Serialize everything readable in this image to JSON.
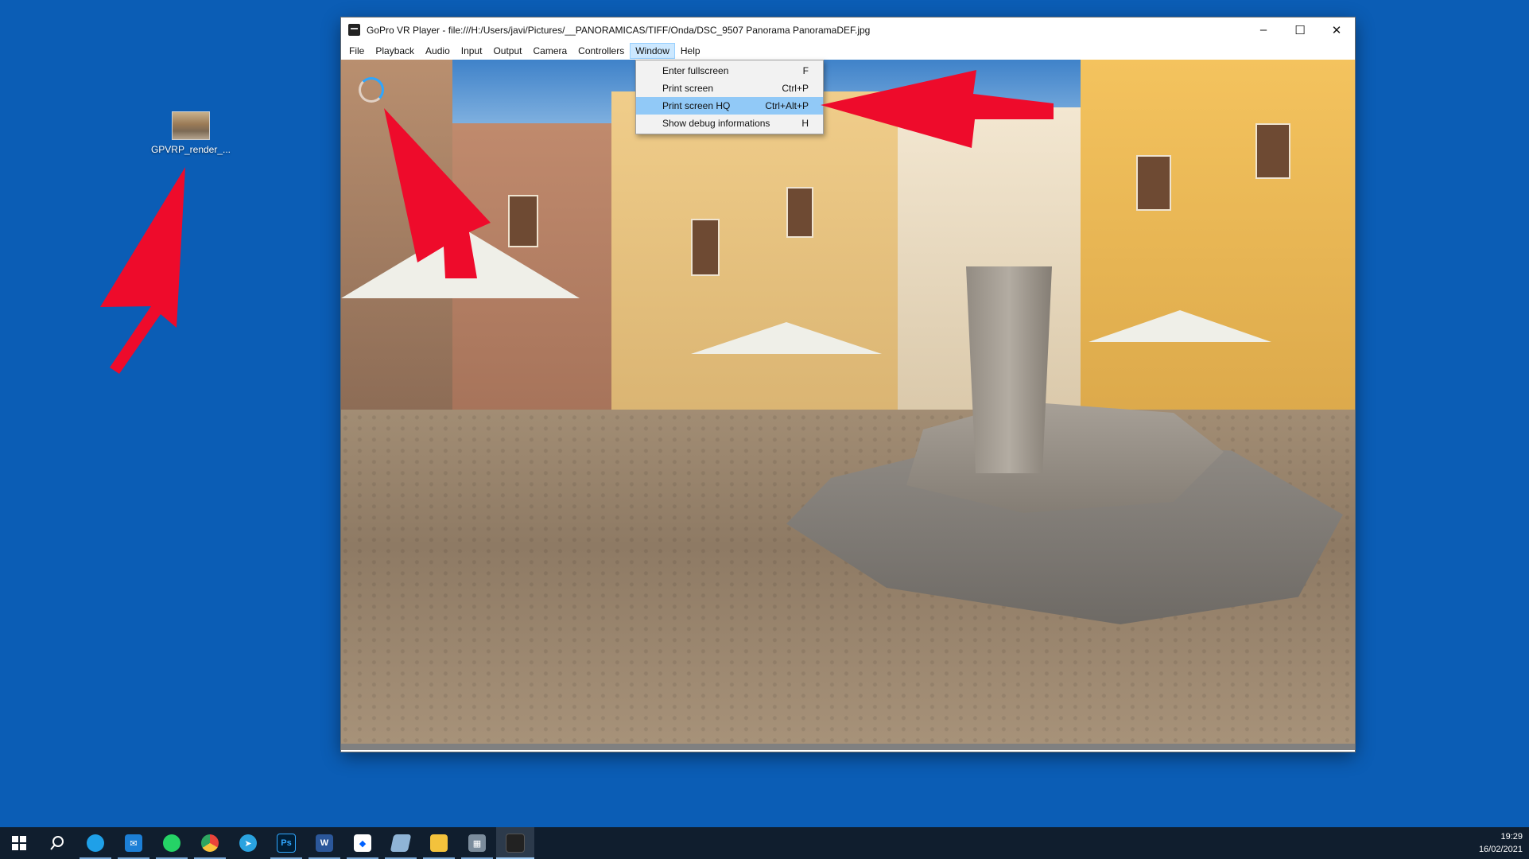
{
  "desktop": {
    "icon_label": "GPVRP_render_..."
  },
  "window": {
    "title": "GoPro VR Player - file:///H:/Users/javi/Pictures/__PANORAMICAS/TIFF/Onda/DSC_9507 Panorama PanoramaDEF.jpg",
    "controls": {
      "minimize": "–",
      "maximize": "☐",
      "close": "✕"
    }
  },
  "menubar": [
    "File",
    "Playback",
    "Audio",
    "Input",
    "Output",
    "Camera",
    "Controllers",
    "Window",
    "Help"
  ],
  "window_menu": [
    {
      "label": "Enter fullscreen",
      "shortcut": "F"
    },
    {
      "label": "Print screen",
      "shortcut": "Ctrl+P"
    },
    {
      "label": "Print screen HQ",
      "shortcut": "Ctrl+Alt+P"
    },
    {
      "label": "Show debug informations",
      "shortcut": "H"
    }
  ],
  "taskbar": {
    "apps": [
      {
        "name": "start",
        "icon": "windows-icon"
      },
      {
        "name": "search",
        "icon": "search-icon"
      },
      {
        "name": "edge",
        "icon": "edge-icon",
        "color": "#1fa0e8"
      },
      {
        "name": "mail",
        "icon": "mail-icon",
        "color": "#1c7fd6"
      },
      {
        "name": "whatsapp",
        "icon": "whatsapp-icon",
        "color": "#25d366"
      },
      {
        "name": "chrome",
        "icon": "chrome-icon",
        "color": "#e9443a"
      },
      {
        "name": "telegram",
        "icon": "telegram-icon",
        "color": "#2aa3e0"
      },
      {
        "name": "photoshop",
        "icon": "photoshop-icon",
        "color": "#31a8ff",
        "text": "Ps"
      },
      {
        "name": "word",
        "icon": "word-icon",
        "color": "#2b579a",
        "text": "W"
      },
      {
        "name": "dropbox",
        "icon": "dropbox-icon",
        "color": "#0061ff"
      },
      {
        "name": "notes",
        "icon": "notes-icon",
        "color": "#8fb4d6"
      },
      {
        "name": "explorer",
        "icon": "file-explorer-icon",
        "color": "#f3c23c"
      },
      {
        "name": "calculator",
        "icon": "calculator-icon",
        "color": "#7b8c9c"
      },
      {
        "name": "gopro",
        "icon": "gopro-vr-player-icon",
        "color": "#222"
      }
    ],
    "time": "19:29",
    "date": "16/02/2021"
  }
}
